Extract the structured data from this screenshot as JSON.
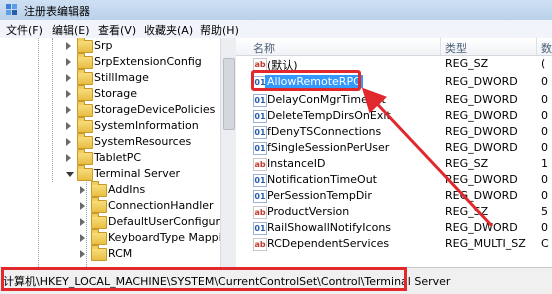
{
  "window": {
    "title": "注册表编辑器"
  },
  "menu": [
    "文件(F)",
    "编辑(E)",
    "查看(V)",
    "收藏夹(A)",
    "帮助(H)"
  ],
  "tree": {
    "items": [
      {
        "label": "Srp",
        "expanded": false
      },
      {
        "label": "SrpExtensionConfig",
        "expanded": false
      },
      {
        "label": "StillImage",
        "expanded": false
      },
      {
        "label": "Storage",
        "expanded": false
      },
      {
        "label": "StorageDevicePolicies",
        "expanded": false
      },
      {
        "label": "SystemInformation",
        "expanded": false
      },
      {
        "label": "SystemResources",
        "expanded": false
      },
      {
        "label": "TabletPC",
        "expanded": false
      },
      {
        "label": "Terminal Server",
        "expanded": true
      },
      {
        "label": "AddIns",
        "expanded": false
      },
      {
        "label": "ConnectionHandler",
        "expanded": false
      },
      {
        "label": "DefaultUserConfiguration",
        "expanded": false
      },
      {
        "label": "KeyboardType Mapping",
        "expanded": false
      },
      {
        "label": "RCM",
        "expanded": false
      }
    ]
  },
  "list": {
    "headers": {
      "name": "名称",
      "type": "类型",
      "data": "数"
    },
    "rows": [
      {
        "name": "(默认)",
        "type": "REG_SZ",
        "data": "(",
        "icon": "string-value-icon"
      },
      {
        "name": "AllowRemoteRPC",
        "type": "REG_DWORD",
        "data": "0",
        "icon": "dword-value-icon",
        "selected": true
      },
      {
        "name": "DelayConMgrTimeout",
        "type": "REG_DWORD",
        "data": "0",
        "icon": "dword-value-icon"
      },
      {
        "name": "DeleteTempDirsOnExit",
        "type": "REG_DWORD",
        "data": "0",
        "icon": "dword-value-icon"
      },
      {
        "name": "fDenyTSConnections",
        "type": "REG_DWORD",
        "data": "0",
        "icon": "dword-value-icon"
      },
      {
        "name": "fSingleSessionPerUser",
        "type": "REG_DWORD",
        "data": "0",
        "icon": "dword-value-icon"
      },
      {
        "name": "InstanceID",
        "type": "REG_SZ",
        "data": "1",
        "icon": "string-value-icon"
      },
      {
        "name": "NotificationTimeOut",
        "type": "REG_DWORD",
        "data": "0",
        "icon": "dword-value-icon"
      },
      {
        "name": "PerSessionTempDir",
        "type": "REG_DWORD",
        "data": "0",
        "icon": "dword-value-icon"
      },
      {
        "name": "ProductVersion",
        "type": "REG_SZ",
        "data": "5",
        "icon": "string-value-icon"
      },
      {
        "name": "RailShowallNotifyIcons",
        "type": "REG_DWORD",
        "data": "0",
        "icon": "dword-value-icon"
      },
      {
        "name": "RCDependentServices",
        "type": "REG_MULTI_SZ",
        "data": "C",
        "icon": "string-value-icon"
      }
    ]
  },
  "status": {
    "path": "计算机\\HKEY_LOCAL_MACHINE\\SYSTEM\\CurrentControlSet\\Control\\Terminal Server"
  },
  "colors": {
    "highlight": "#e0282d",
    "selection": "#3399ff"
  }
}
